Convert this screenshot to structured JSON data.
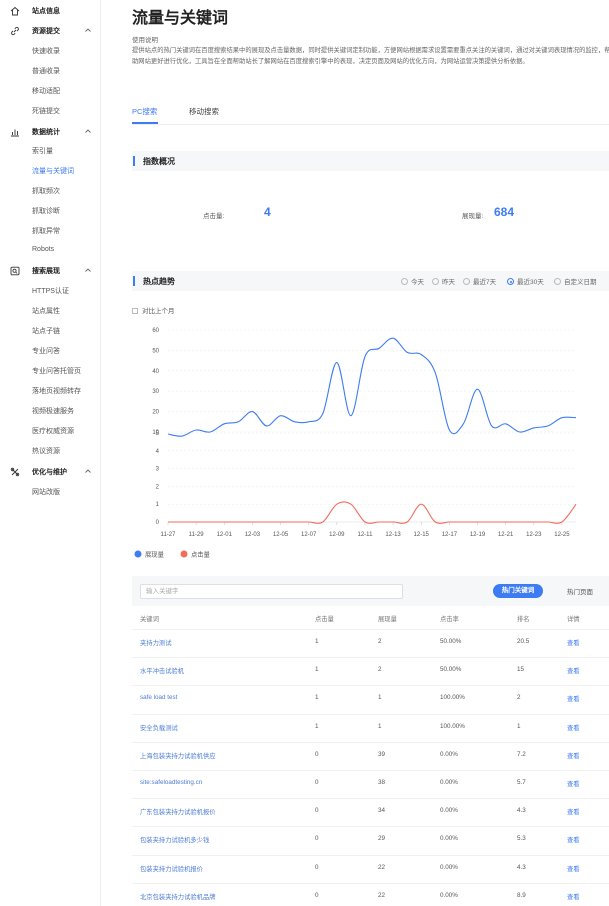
{
  "sidebar": {
    "groups": [
      {
        "label": "站点信息",
        "icon": "home-icon",
        "items": []
      },
      {
        "label": "资源提交",
        "icon": "link-icon",
        "items": [
          "快速收录",
          "普通收录",
          "移动适配",
          "死链提交"
        ]
      },
      {
        "label": "数据统计",
        "icon": "bar-chart-icon",
        "items": [
          "索引量",
          "流量与关键词",
          "抓取频次",
          "抓取诊断",
          "抓取异常",
          "Robots"
        ]
      },
      {
        "label": "搜索展现",
        "icon": "search-display-icon",
        "items": [
          "HTTPS认证",
          "站点属性",
          "站点子链",
          "专业问答",
          "专业问答托管页",
          "落地页视频转存",
          "视频极速服务",
          "医疗权威资源",
          "热议资源"
        ]
      },
      {
        "label": "优化与维护",
        "icon": "tools-icon",
        "items": [
          "网站改版"
        ]
      }
    ],
    "active_item": "流量与关键词"
  },
  "page": {
    "title": "流量与关键词",
    "usage_label": "使用说明",
    "usage_desc": "提供站点的热门关键词在百度搜索结果中的展现及点击量数据，同时提供关键词定制功能，方便网站根据需求设置需要重点关注的关键词，通过对关键词表现情况的监控，帮助网站更好进行优化，工具旨在全面帮助站长了解网站在百度搜索引擎中的表现，决定页面及网站的优化方向，为网站运营决策提供分析依据。"
  },
  "tabs": {
    "pc": "PC搜索",
    "mobile": "移动搜索"
  },
  "overview": {
    "title": "指数概况",
    "clicks_label": "点击量:",
    "clicks_value": "4",
    "impressions_label": "展现量:",
    "impressions_value": "684"
  },
  "trend": {
    "title": "热点趋势",
    "ranges": [
      "今天",
      "昨天",
      "最近7天",
      "最近30天",
      "自定义日期"
    ],
    "selected_range": "最近30天",
    "compare_label": "对比上个月"
  },
  "chart_data": {
    "type": "line",
    "x_labels": [
      "11-27",
      "11-29",
      "12-01",
      "12-03",
      "12-05",
      "12-07",
      "12-09",
      "12-11",
      "12-13",
      "12-15",
      "12-17",
      "12-19",
      "12-21",
      "12-23",
      "12-25"
    ],
    "upper_ticks": [
      "60",
      "50",
      "40",
      "30",
      "20",
      "10"
    ],
    "lower_ticks": [
      "5",
      "4",
      "3",
      "2",
      "1",
      "0"
    ],
    "upper_range": [
      10,
      60
    ],
    "lower_range": [
      0,
      5
    ],
    "grid": true,
    "legend_position": "bottom-left",
    "series": [
      {
        "name": "展现量",
        "color": "#3d7cf2",
        "values": [
          9,
          8,
          11,
          10,
          14,
          15,
          20,
          13,
          18,
          15,
          15,
          19,
          44,
          18,
          47,
          51,
          56,
          49,
          48,
          39,
          11,
          14,
          31,
          13,
          14,
          10,
          12,
          13,
          17,
          17
        ]
      },
      {
        "name": "点击量",
        "color": "#f26b5b",
        "values": [
          0,
          0,
          0,
          0,
          0,
          0,
          0,
          0,
          0,
          0,
          0,
          0,
          1,
          1,
          0,
          0,
          0,
          0,
          1,
          0,
          0,
          0,
          0,
          0,
          0,
          0,
          0,
          0,
          0,
          1
        ]
      }
    ]
  },
  "table": {
    "search_placeholder": "输入关键字",
    "hot_keywords_btn": "热门关键词",
    "hot_pages_btn": "热门页面",
    "headers": [
      "关键词",
      "点击量",
      "展现量",
      "点击率",
      "排名",
      "详情"
    ],
    "rows": [
      [
        "夹持力测试",
        "1",
        "2",
        "50.00%",
        "20.5",
        "查看"
      ],
      [
        "水平冲击试验机",
        "1",
        "2",
        "50.00%",
        "15",
        "查看"
      ],
      [
        "safe load test",
        "1",
        "1",
        "100.00%",
        "2",
        "查看"
      ],
      [
        "安全负载测试",
        "1",
        "1",
        "100.00%",
        "1",
        "查看"
      ],
      [
        "上海包装夹持力试验机供应",
        "0",
        "39",
        "0.00%",
        "7.2",
        "查看"
      ],
      [
        "site:safeloadtesting.cn",
        "0",
        "38",
        "0.00%",
        "5.7",
        "查看"
      ],
      [
        "广东包装夹持力试验机报价",
        "0",
        "34",
        "0.00%",
        "4.3",
        "查看"
      ],
      [
        "包装夹持力试验机多少钱",
        "0",
        "29",
        "0.00%",
        "5.3",
        "查看"
      ],
      [
        "包装夹持力试验机报价",
        "0",
        "22",
        "0.00%",
        "4.3",
        "查看"
      ],
      [
        "北京包装夹持力试验机品牌",
        "0",
        "22",
        "0.00%",
        "8.9",
        "查看"
      ]
    ]
  }
}
